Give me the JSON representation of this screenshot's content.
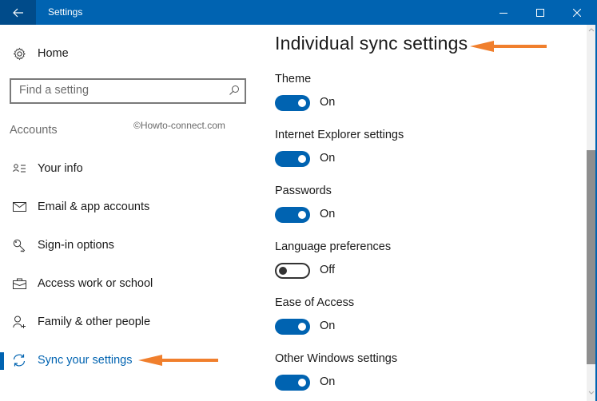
{
  "window": {
    "title": "Settings",
    "controls": [
      "minimize",
      "maximize",
      "close"
    ]
  },
  "sidebar": {
    "home_label": "Home",
    "search": {
      "placeholder": "Find a setting",
      "value": ""
    },
    "section_label": "Accounts",
    "watermark": "©Howto-connect.com",
    "items": [
      {
        "label": "Your info",
        "icon": "person-list-icon",
        "active": false
      },
      {
        "label": "Email & app accounts",
        "icon": "envelope-icon",
        "active": false
      },
      {
        "label": "Sign-in options",
        "icon": "key-icon",
        "active": false
      },
      {
        "label": "Access work or school",
        "icon": "briefcase-icon",
        "active": false
      },
      {
        "label": "Family & other people",
        "icon": "person-add-icon",
        "active": false
      },
      {
        "label": "Sync your settings",
        "icon": "sync-icon",
        "active": true
      }
    ]
  },
  "main": {
    "title": "Individual sync settings",
    "settings": [
      {
        "label": "Theme",
        "state": "On",
        "on": true
      },
      {
        "label": "Internet Explorer settings",
        "state": "On",
        "on": true
      },
      {
        "label": "Passwords",
        "state": "On",
        "on": true
      },
      {
        "label": "Language preferences",
        "state": "Off",
        "on": false
      },
      {
        "label": "Ease of Access",
        "state": "On",
        "on": true
      },
      {
        "label": "Other Windows settings",
        "state": "On",
        "on": true
      }
    ]
  },
  "colors": {
    "accent": "#0063b1",
    "titlebar_back": "#004b8a",
    "annotation_arrow": "#f07f2d"
  }
}
